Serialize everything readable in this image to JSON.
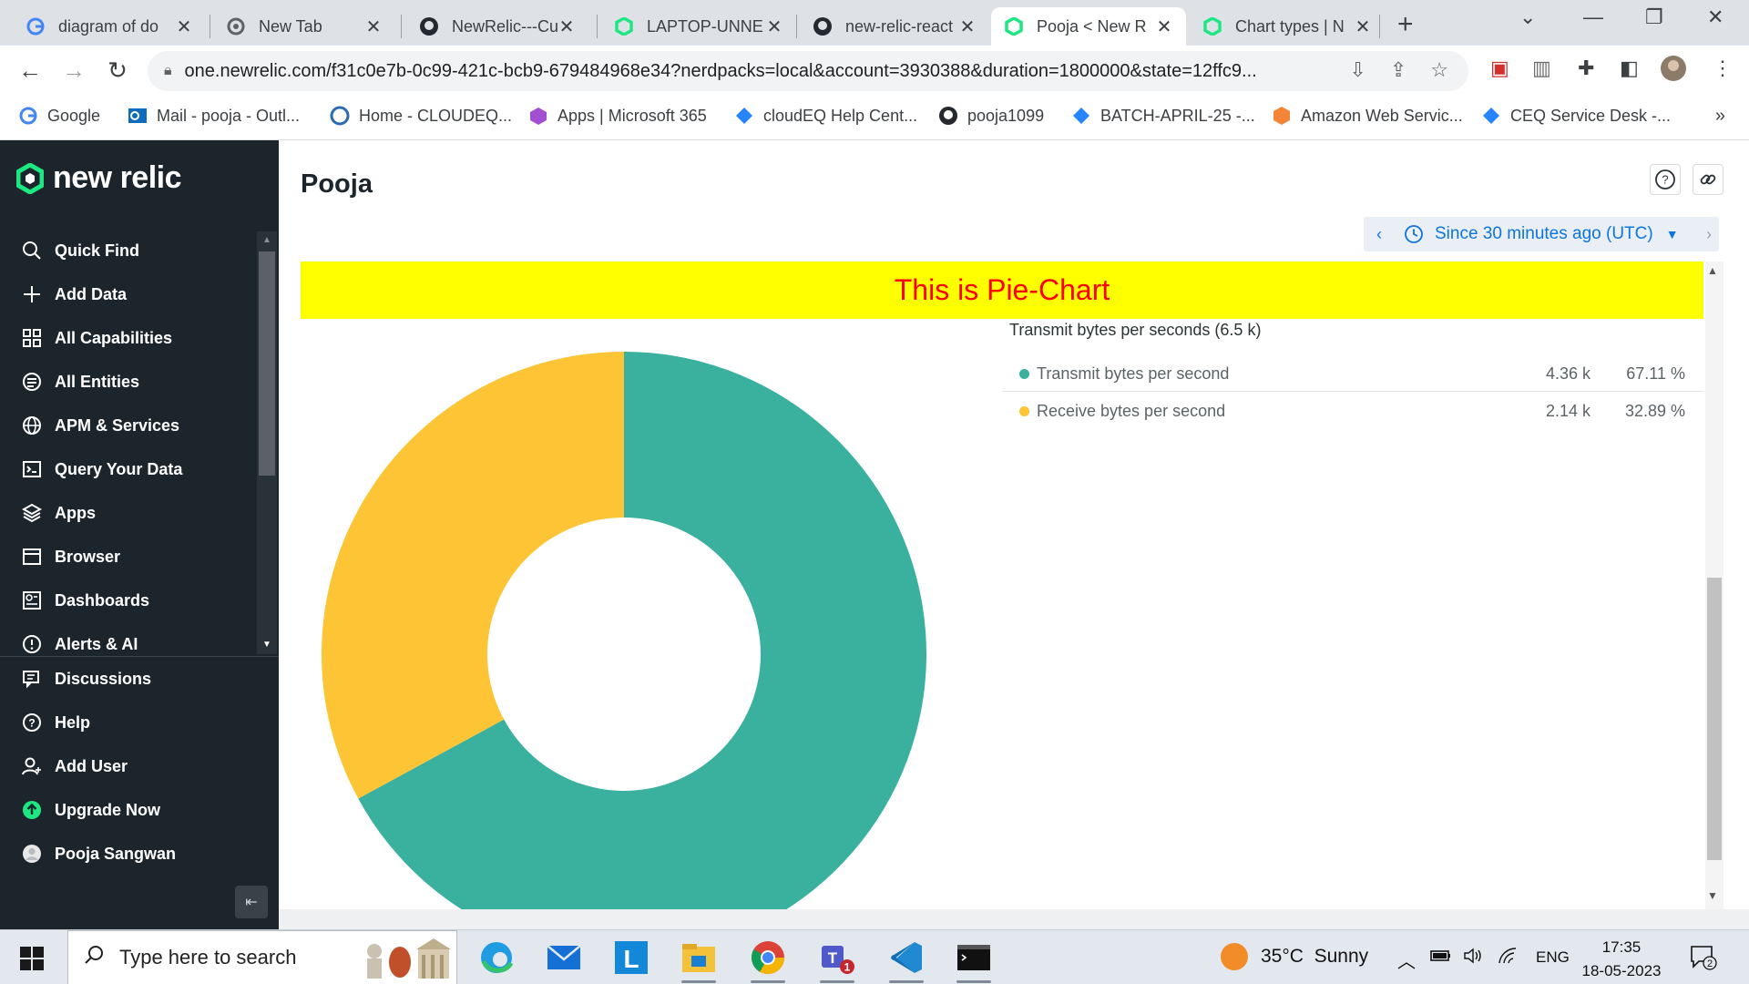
{
  "browser": {
    "tabs": [
      {
        "title": "diagram of do",
        "icon": "google-icon"
      },
      {
        "title": "New Tab",
        "icon": "chrome-icon"
      },
      {
        "title": "NewRelic---Cu",
        "icon": "github-icon"
      },
      {
        "title": "LAPTOP-UNNE",
        "icon": "new-relic-icon"
      },
      {
        "title": "new-relic-react",
        "icon": "github-icon"
      },
      {
        "title": "Pooja < New R",
        "icon": "new-relic-icon",
        "active": true
      },
      {
        "title": "Chart types | N",
        "icon": "new-relic-icon"
      }
    ],
    "url": "one.newrelic.com/f31c0e7b-0c99-421c-bcb9-679484968e34?nerdpacks=local&account=3930388&duration=1800000&state=12ffc9...",
    "bookmarks": [
      {
        "label": "Google",
        "icon": "google-icon"
      },
      {
        "label": "Mail - pooja - Outl...",
        "icon": "outlook-icon"
      },
      {
        "label": "Home - CLOUDEQ...",
        "icon": "cloudeq-icon"
      },
      {
        "label": "Apps | Microsoft 365",
        "icon": "microsoft365-icon"
      },
      {
        "label": "cloudEQ Help Cent...",
        "icon": "jira-icon"
      },
      {
        "label": "pooja1099",
        "icon": "github-icon"
      },
      {
        "label": "BATCH-APRIL-25 -...",
        "icon": "jira-icon"
      },
      {
        "label": "Amazon Web Servic...",
        "icon": "aws-icon"
      },
      {
        "label": "CEQ Service Desk -...",
        "icon": "jira-icon"
      }
    ]
  },
  "sidebar": {
    "logo_text": "new relic",
    "items": [
      {
        "label": "Quick Find",
        "icon": "search-icon"
      },
      {
        "label": "Add Data",
        "icon": "plus-icon"
      },
      {
        "label": "All Capabilities",
        "icon": "grid-icon"
      },
      {
        "label": "All Entities",
        "icon": "entities-icon"
      },
      {
        "label": "APM & Services",
        "icon": "globe-icon"
      },
      {
        "label": "Query Your Data",
        "icon": "terminal-icon"
      },
      {
        "label": "Apps",
        "icon": "layers-icon"
      },
      {
        "label": "Browser",
        "icon": "browser-icon"
      },
      {
        "label": "Dashboards",
        "icon": "dashboard-icon"
      },
      {
        "label": "Alerts & AI",
        "icon": "alert-icon"
      }
    ],
    "bottom_items": [
      {
        "label": "Discussions",
        "icon": "discussions-icon"
      },
      {
        "label": "Help",
        "icon": "help-icon"
      },
      {
        "label": "Add User",
        "icon": "add-user-icon"
      },
      {
        "label": "Upgrade Now",
        "icon": "upgrade-icon"
      },
      {
        "label": "Pooja Sangwan",
        "icon": "avatar-icon"
      }
    ]
  },
  "main": {
    "title": "Pooja",
    "time_range": "Since 30 minutes ago (UTC)",
    "banner": "This is Pie-Chart"
  },
  "chart_data": {
    "type": "pie",
    "title": "Transmit bytes per seconds (6.5 k)",
    "donut": true,
    "series": [
      {
        "name": "Transmit bytes per second",
        "value": 4.36,
        "value_label": "4.36 k",
        "percent": 67.11,
        "percent_label": "67.11 %",
        "color": "#3ab09e"
      },
      {
        "name": "Receive bytes per second",
        "value": 2.14,
        "value_label": "2.14 k",
        "percent": 32.89,
        "percent_label": "32.89 %",
        "color": "#fdc535"
      }
    ]
  },
  "taskbar": {
    "search_placeholder": "Type here to search",
    "weather": "35°C  Sunny",
    "language": "ENG",
    "time": "17:35",
    "date": "18-05-2023",
    "notification_count": "2",
    "teams_badge": "1"
  }
}
